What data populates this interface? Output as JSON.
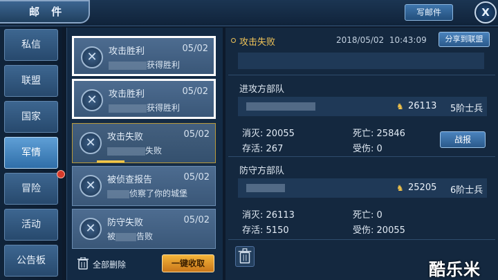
{
  "window": {
    "title": "邮 件",
    "write_label": "写邮件",
    "close_label": "X"
  },
  "sidebar": {
    "items": [
      {
        "label": "私信"
      },
      {
        "label": "联盟"
      },
      {
        "label": "国家"
      },
      {
        "label": "军情",
        "active": true
      },
      {
        "label": "冒险"
      },
      {
        "label": "活动"
      },
      {
        "label": "公告板"
      }
    ]
  },
  "mails": [
    {
      "title": "攻击胜利",
      "date": "05/02",
      "subtitle": "获得胜利"
    },
    {
      "title": "攻击胜利",
      "date": "05/02",
      "subtitle": "获得胜利"
    },
    {
      "title": "攻击失败",
      "date": "05/02",
      "subtitle": "失败"
    },
    {
      "title": "被侦查报告",
      "date": "05/02",
      "subtitle": "侦察了你的城堡"
    },
    {
      "title": "防守失败",
      "date": "05/02",
      "subtitle": "被",
      "subtitle_tail": "告败"
    }
  ],
  "list_footer": {
    "delete_all": "全部删除",
    "collect_all": "一键收取"
  },
  "detail": {
    "title": "攻击失败",
    "date": "2018/05/02",
    "time": "10:43:09",
    "share_label": "分享到联盟",
    "attacker": {
      "section": "进攻方部队",
      "power": "26113",
      "tier": "5阶士兵",
      "killed_label": "消灭:",
      "killed": "20055",
      "dead_label": "死亡:",
      "dead": "25846",
      "alive_label": "存活:",
      "alive": "267",
      "wounded_label": "受伤:",
      "wounded": "0",
      "battle_label": "战报"
    },
    "defender": {
      "section": "防守方部队",
      "power": "25205",
      "tier": "6阶士兵",
      "killed_label": "消灭:",
      "killed": "26113",
      "dead_label": "死亡:",
      "dead": "0",
      "alive_label": "存活:",
      "alive": "5150",
      "wounded_label": "受伤:",
      "wounded": "20055"
    }
  },
  "watermark": "酷乐米",
  "colors": {
    "accent_gold": "#f1c458",
    "active_tab": "#5f9fd6",
    "notify_dot": "#d63a2a"
  }
}
